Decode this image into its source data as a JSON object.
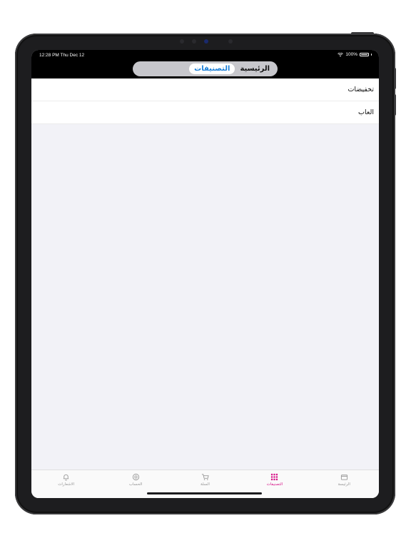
{
  "status_bar": {
    "time": "12:28 PM  Thu Dec 12",
    "battery": "100%"
  },
  "segmented": {
    "items": [
      {
        "label": "الرئيسية",
        "active": false
      },
      {
        "label": "التصنيفات",
        "active": true
      }
    ]
  },
  "list": {
    "rows": [
      {
        "label": "تخفيضات"
      },
      {
        "label": "العاب"
      }
    ]
  },
  "tabbar": {
    "items": [
      {
        "label": "الرئيسة",
        "icon": "store-icon",
        "active": false
      },
      {
        "label": "التصنيفات",
        "icon": "grid-icon",
        "active": true
      },
      {
        "label": "السلة",
        "icon": "cart-icon",
        "active": false
      },
      {
        "label": "الحساب",
        "icon": "account-icon",
        "active": false
      },
      {
        "label": "الاشعارات",
        "icon": "bell-icon",
        "active": false
      }
    ]
  },
  "colors": {
    "accent_tab": "#d81b8c",
    "accent_segment": "#1a7fd8"
  }
}
